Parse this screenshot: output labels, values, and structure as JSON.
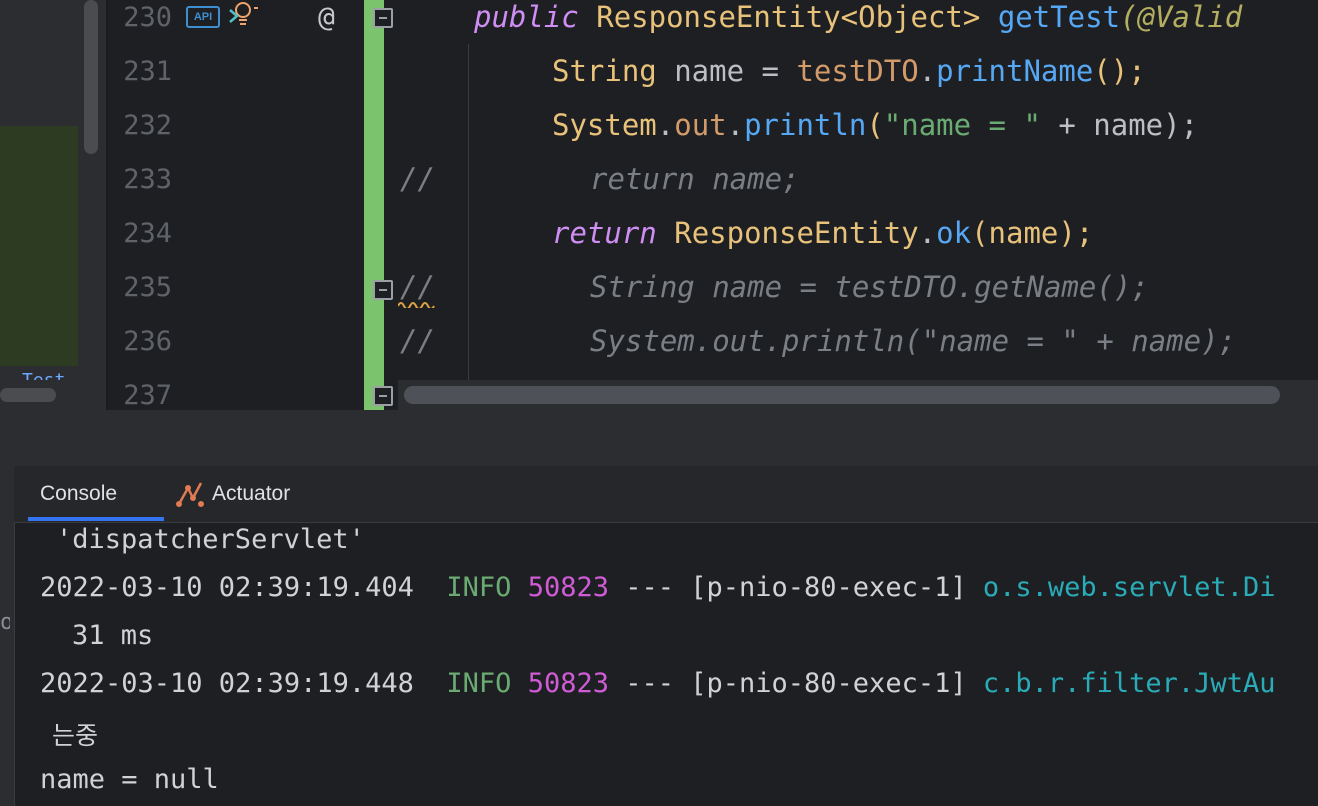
{
  "editor": {
    "line_numbers": [
      "230",
      "231",
      "232",
      "233",
      "234",
      "235",
      "236",
      "237"
    ],
    "gutter_at": "@",
    "gutter_api": "API",
    "line_230": {
      "kw": "public",
      "cls": "ResponseEntity<Object>",
      "fn": "getTest",
      "ann": "(@Valid"
    },
    "line_231": {
      "type": "String",
      "rest1": " name = ",
      "var": "testDTO",
      "dot": ".",
      "fn": "printName",
      "tail": "();"
    },
    "line_232": {
      "type": "System",
      "dot": ".",
      "field": "out",
      "dot2": ".",
      "fn": "println",
      "open": "(",
      "str": "\"name = \"",
      "rest": " + name);"
    },
    "line_233": {
      "slashes": "//",
      "comment": "return name;"
    },
    "line_234": {
      "kw": "return",
      "cls": "ResponseEntity",
      "dot": ".",
      "fn": "ok",
      "rest": "(name);"
    },
    "line_235": {
      "slashes": "//",
      "comment": "String name = testDTO.getName();"
    },
    "line_236": {
      "slashes": "//",
      "comment": "System.out.println(\"name = \" + name);"
    }
  },
  "left_panel": {
    "fragment": "Test"
  },
  "tool_window": {
    "tabs": [
      {
        "label": "Console",
        "active": true
      },
      {
        "label": "Actuator",
        "active": false
      }
    ],
    "gutter_fragment": "oc"
  },
  "console": {
    "lines": [
      {
        "text": "'dispatcherServlet'"
      },
      {
        "ts": "2022-03-10 02:39:19.404",
        "level": "INFO",
        "pid": "50823",
        "sep": " --- ",
        "thread": "[p-nio-80-exec-1]",
        "logger": "o.s.web.servlet.Di"
      },
      {
        "text": "31 ms"
      },
      {
        "ts": "2022-03-10 02:39:19.448",
        "level": "INFO",
        "pid": "50823",
        "sep": " --- ",
        "thread": "[p-nio-80-exec-1]",
        "logger": "c.b.r.filter.JwtAu"
      },
      {
        "text": "는중"
      },
      {
        "text": "name = null"
      }
    ]
  },
  "colors": {
    "green_change_bar": "#7cc36e",
    "accent": "#3574f0",
    "info": "#6aab73",
    "pid": "#d05bd6",
    "logger": "#2aacb8"
  }
}
